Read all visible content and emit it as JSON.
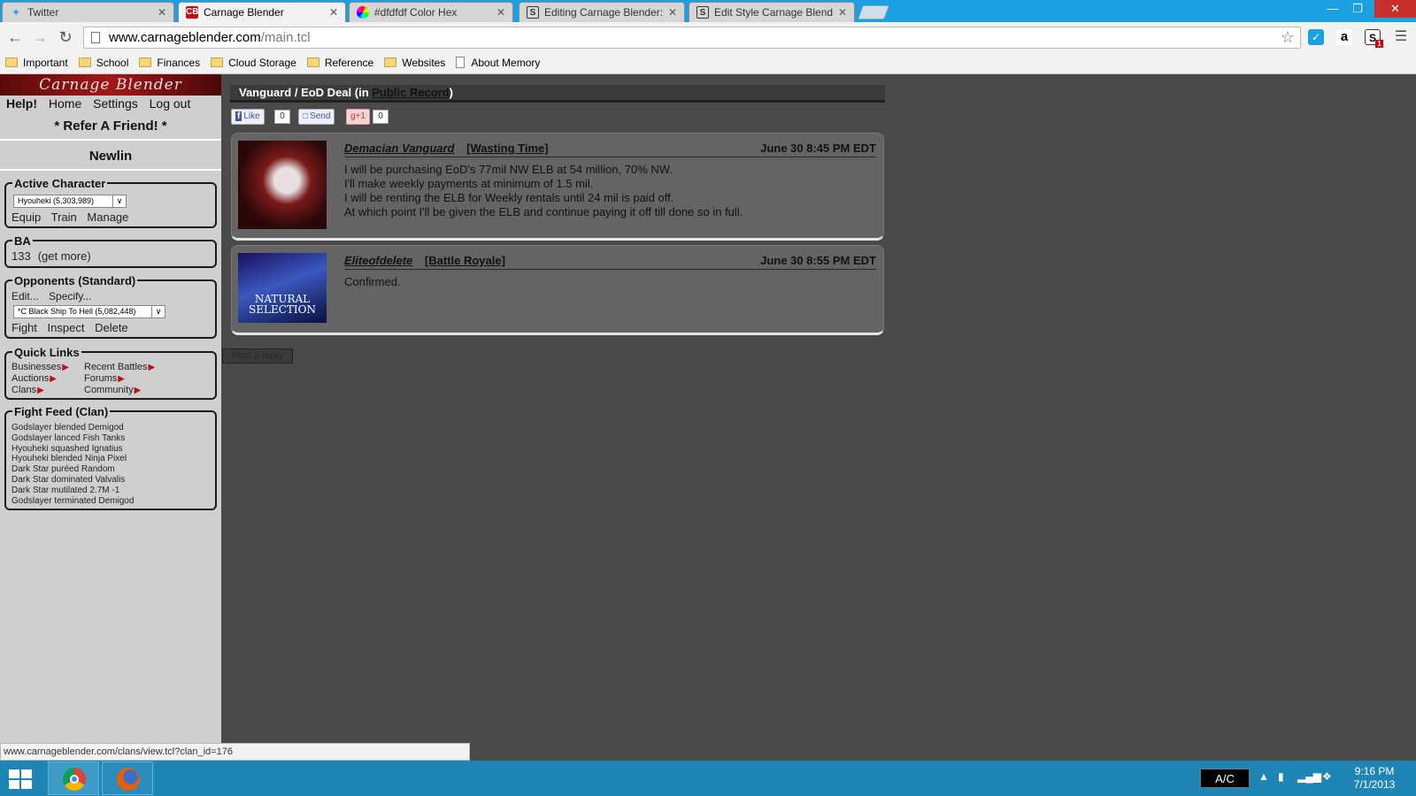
{
  "browser": {
    "tabs": [
      {
        "label": "Twitter",
        "icon": "twitter-icon"
      },
      {
        "label": "Carnage Blender",
        "icon": "cb-icon",
        "icon_text": "CB",
        "active": true
      },
      {
        "label": "#dfdfdf Color Hex",
        "icon": "color-wheel-icon"
      },
      {
        "label": "Editing Carnage Blender: [",
        "icon": "stylish-icon",
        "icon_text": "S"
      },
      {
        "label": "Edit Style Carnage Blender",
        "icon": "stylish-icon",
        "icon_text": "S"
      }
    ],
    "url_host": "www.carnageblender.com",
    "url_path": "/main.tcl",
    "extensions": [
      "extension-blue-icon",
      "amazon-icon",
      "stylish-extension-icon"
    ],
    "extension_badge": "1",
    "amazon_text": "a",
    "stylish_text": "S",
    "bookmarks": [
      {
        "label": "Important",
        "type": "folder"
      },
      {
        "label": "School",
        "type": "folder"
      },
      {
        "label": "Finances",
        "type": "folder"
      },
      {
        "label": "Cloud Storage",
        "type": "folder"
      },
      {
        "label": "Reference",
        "type": "folder"
      },
      {
        "label": "Websites",
        "type": "folder"
      },
      {
        "label": "About Memory",
        "type": "page"
      }
    ],
    "status_url": "www.carnageblender.com/clans/view.tcl?clan_id=176"
  },
  "sidebar": {
    "logo_text": "Carnage Blender",
    "nav": [
      "Help!",
      "Home",
      "Settings",
      "Log out"
    ],
    "refer": "* Refer A Friend! *",
    "username": "Newlin",
    "active_character": {
      "legend": "Active Character",
      "selected": "Hyouheki (5,303,989)",
      "actions": [
        "Equip",
        "Train",
        "Manage"
      ]
    },
    "ba": {
      "legend": "BA",
      "value": "133",
      "link": "(get more)"
    },
    "opponents": {
      "legend": "Opponents (Standard)",
      "links": [
        "Edit...",
        "Specify..."
      ],
      "selected": "*C Black Ship To Hell (5,082,448)",
      "actions": [
        "Fight",
        "Inspect",
        "Delete"
      ]
    },
    "quick_links": {
      "legend": "Quick Links",
      "items": [
        "Businesses",
        "Recent Battles",
        "Auctions",
        "Forums",
        "Clans",
        "Community"
      ]
    },
    "fight_feed": {
      "legend": "Fight Feed (Clan)",
      "items": [
        "Godslayer blended Demigod",
        "Godslayer lanced Fish Tanks",
        "Hyouheki squashed Ignatius",
        "Hyouheki blended Ninja Pixel",
        "Dark Star puréed Random",
        "Dark Star dominated Valvalis",
        "Dark Star mutilated 2.7M -1",
        "Godslayer terminated Demigod"
      ]
    }
  },
  "thread": {
    "title_prefix": "Vanguard / EoD Deal (in ",
    "forum": "Public Record",
    "title_suffix": ")",
    "social": {
      "like": "Like",
      "like_count": "0",
      "send": "Send",
      "plus": "+1",
      "plus_count": "0"
    },
    "posts": [
      {
        "author": "Demacian Vanguard",
        "title": "[Wasting Time]",
        "date": "June 30 8:45 PM EDT",
        "body": [
          "I will be purchasing EoD's 77mil NW ELB at 54 million, 70% NW.",
          "I'll make weekly payments at minimum of 1.5 mil.",
          "I will be renting the ELB for Weekly rentals until 24 mil is paid off.",
          "At which point I'll be given the ELB and continue paying it off till done so in full."
        ]
      },
      {
        "author": "Eliteofdelete",
        "title": "[Battle Royale]",
        "date": "June 30 8:55 PM EDT",
        "body": [
          "Confirmed."
        ],
        "avatar_text": [
          "NATURAL",
          "SELECTION"
        ]
      }
    ],
    "reply_label": "Post a reply"
  },
  "taskbar": {
    "apps": [
      "chrome-icon",
      "firefox-icon"
    ],
    "ac_label": "A/C",
    "time": "9:16 PM",
    "date": "7/1/2013"
  },
  "colors": {
    "tabstrip": "#1ba1e2",
    "page_bg": "#4a4a4a",
    "sidebar_bg": "#cfcfcf",
    "post_bg": "#646464",
    "taskbar": "#1f85b5"
  }
}
